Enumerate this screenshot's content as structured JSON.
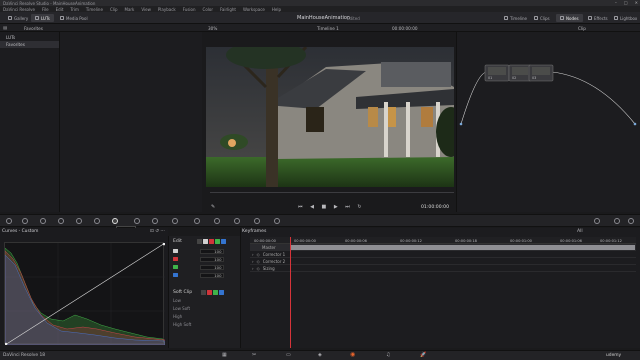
{
  "window": {
    "title": "DaVinci Resolve Studio - MainHouseAnimation"
  },
  "menu": [
    "DaVinci Resolve",
    "File",
    "Edit",
    "Trim",
    "Timeline",
    "Clip",
    "Mark",
    "View",
    "Playback",
    "Fusion",
    "Color",
    "Fairlight",
    "Workspace",
    "Help"
  ],
  "toolbar": {
    "gallery": "Gallery",
    "luts": "LUTs",
    "media_pool": "Media Pool",
    "project_title": "MainHouseAnimation",
    "edited": "Edited",
    "timeline_btn": "Timeline",
    "clips_btn": "Clips",
    "nodes_btn": "Nodes",
    "effects_btn": "Effects",
    "lightbox_btn": "Lightbox"
  },
  "subbar": {
    "favorites": "Favorites",
    "zoom": "30%",
    "timeline_name": "Timeline 1",
    "timecode": "00:00:00:00",
    "clip_mode": "Clip"
  },
  "left_tree": [
    "LUTs",
    "Favorites"
  ],
  "viewer": {
    "timecode": "01:00:00:00"
  },
  "nodes": [
    {
      "label": "01"
    },
    {
      "label": "02"
    },
    {
      "label": "03"
    }
  ],
  "tooltip": "Curves",
  "curves": {
    "title": "Curves - Custom"
  },
  "edit": {
    "label": "Edit",
    "channels": [
      {
        "color": "#d0d0d0",
        "value": "100"
      },
      {
        "color": "#d0343a",
        "value": "100"
      },
      {
        "color": "#3fb34a",
        "value": "100"
      },
      {
        "color": "#3474d0",
        "value": "100"
      }
    ],
    "soft_clip": "Soft Clip",
    "sc_rows": [
      "Low",
      "Low Soft",
      "High",
      "High Soft"
    ]
  },
  "keyframes": {
    "title": "Keyframes",
    "filter": "All",
    "ruler": [
      "00:00:00:00",
      "00:00:00:00",
      "00:00:00:06",
      "00:00:00:12",
      "00:00:00:18",
      "00:00:01:00",
      "00:00:01:06",
      "00:00:01:12"
    ],
    "tracks": [
      "Master",
      "Corrector 1",
      "Corrector 2",
      "Sizing"
    ]
  },
  "status": {
    "app": "DaVinci Resolve 18",
    "udemy": "udemy"
  },
  "colors": {
    "accent": "#e8642c",
    "playhead": "#d6343a"
  }
}
